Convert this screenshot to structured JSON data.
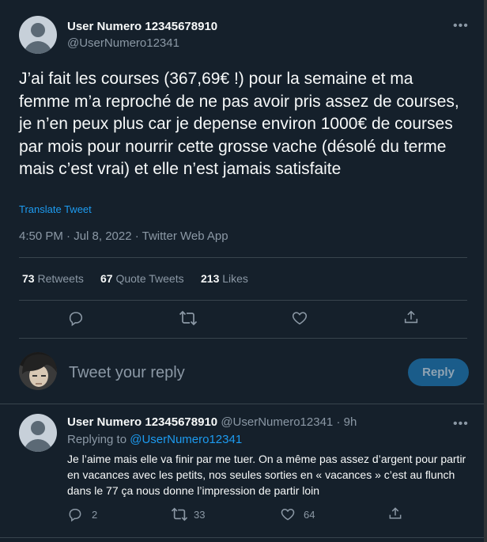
{
  "main_tweet": {
    "display_name": "User Numero 12345678910",
    "handle": "@UserNumero12341",
    "text": "J’ai fait les courses (367,69€ !) pour la semaine et ma femme m’a reproché de ne pas avoir pris assez de courses, je n’en peux plus car je depense environ 1000€ de courses par mois pour nourrir cette grosse vache (désolé du terme mais c’est vrai) et elle n’est jamais satisfaite",
    "translate_label": "Translate Tweet",
    "meta": "4:50 PM · Jul 8, 2022 · Twitter Web App",
    "stats": {
      "retweets_count": "73",
      "retweets_label": "Retweets",
      "quote_count": "67",
      "quote_label": "Quote Tweets",
      "likes_count": "213",
      "likes_label": "Likes"
    }
  },
  "composer": {
    "placeholder": "Tweet your reply",
    "button_label": "Reply"
  },
  "reply_tweet": {
    "display_name": "User Numero 12345678910",
    "handle_time": "@UserNumero12341 · 9h",
    "replying_prefix": "Replying to",
    "replying_handle": "@UserNumero12341",
    "text": "Je l’aime mais elle va finir par me tuer. On a même pas assez d’argent pour partir en vacances avec les petits, nos seules sorties en « vacances » c’est au flunch dans le 77 ça nous donne l’impression de partir loin",
    "reply_count": "2",
    "retweet_count": "33",
    "like_count": "64"
  },
  "icons": {
    "more": "more-dots-icon",
    "reply": "comment-icon",
    "retweet": "retweet-icon",
    "like": "heart-icon",
    "share": "share-icon"
  },
  "colors": {
    "background": "#15202b",
    "accent": "#1d9bf0",
    "muted": "#8b98a5",
    "divider": "#38444d"
  }
}
